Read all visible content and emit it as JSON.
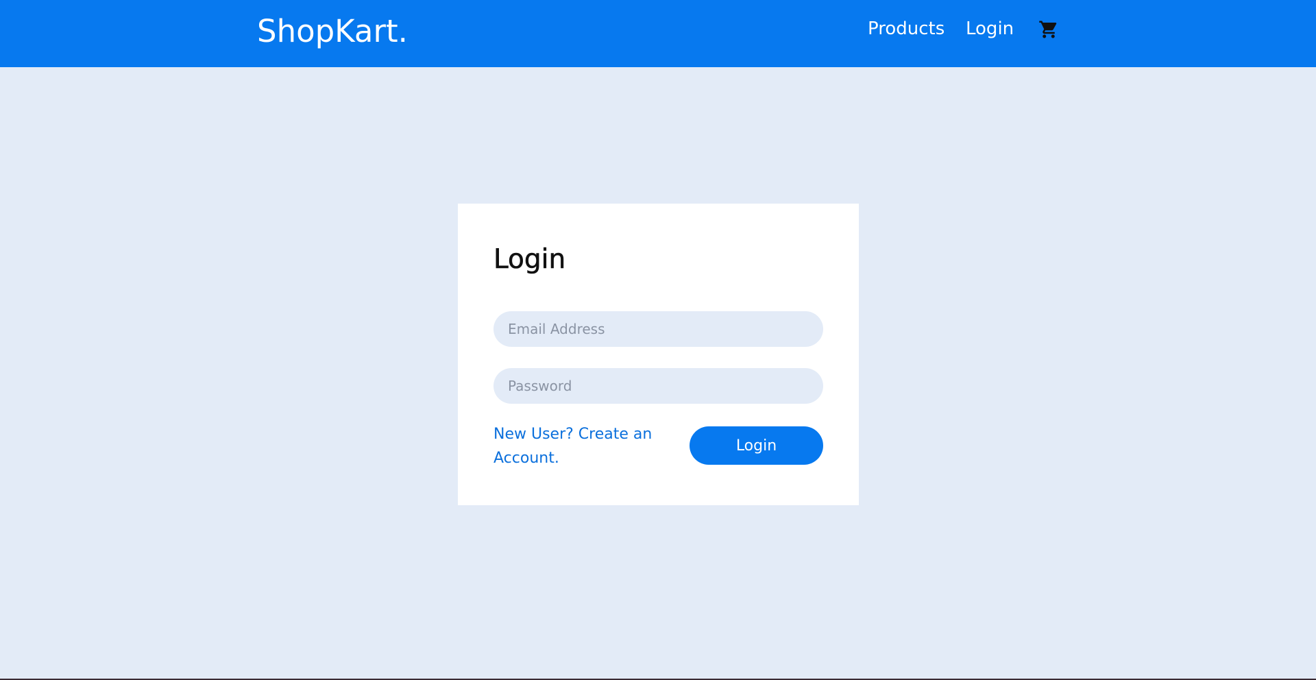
{
  "header": {
    "brand": "ShopKart.",
    "nav": {
      "products_label": "Products",
      "login_label": "Login"
    },
    "cart_icon": "shopping-cart-icon"
  },
  "login_form": {
    "title": "Login",
    "email_placeholder": "Email Address",
    "password_placeholder": "Password",
    "signup_link_label": "New User? Create an Account.",
    "submit_label": "Login"
  },
  "colors": {
    "primary": "#0779ef",
    "page_background": "#e3ebf7",
    "card_background": "#ffffff",
    "link": "#0a6fdc"
  }
}
